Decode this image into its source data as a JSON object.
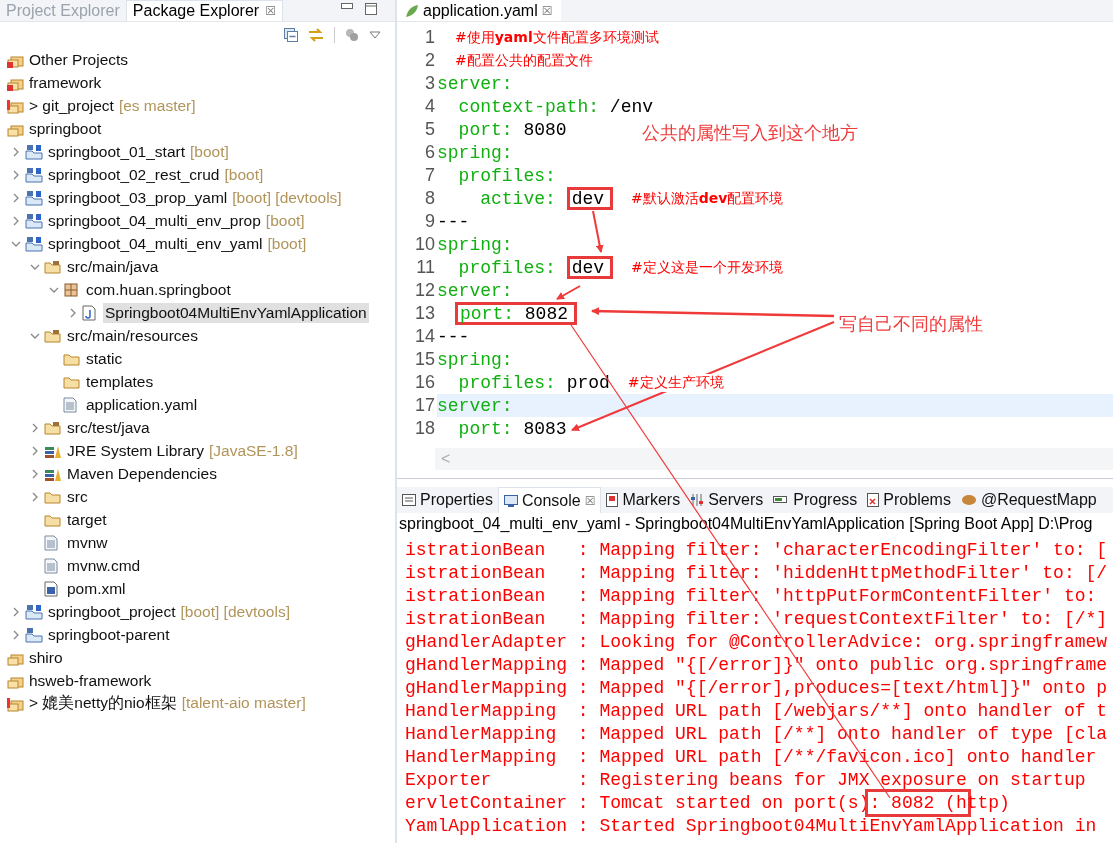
{
  "explorer": {
    "tabs": [
      {
        "label": "Project Explorer",
        "selected": false
      },
      {
        "label": "Package Explorer",
        "selected": true
      }
    ],
    "close_glyph": "☒",
    "tree": [
      {
        "label": "Other Projects",
        "kind": "closed-set",
        "selected": false
      },
      {
        "label": "framework",
        "kind": "closed-set",
        "selected": false
      },
      {
        "label": "> git_project",
        "decoration": "[es master]",
        "kind": "warn-set",
        "selected": false
      },
      {
        "label": "springboot",
        "kind": "set",
        "selected": false,
        "children": [
          {
            "label": "springboot_01_start",
            "decoration": "[boot]",
            "kind": "boot",
            "expanded": false,
            "selected": false
          },
          {
            "label": "springboot_02_rest_crud",
            "decoration": "[boot]",
            "kind": "boot",
            "expanded": false,
            "selected": false
          },
          {
            "label": "springboot_03_prop_yaml",
            "decoration": "[boot] [devtools]",
            "kind": "boot",
            "expanded": false,
            "selected": false
          },
          {
            "label": "springboot_04_multi_env_prop",
            "decoration": "[boot]",
            "kind": "boot",
            "expanded": false,
            "selected": false
          },
          {
            "label": "springboot_04_multi_env_yaml",
            "decoration": "[boot]",
            "kind": "boot",
            "expanded": true,
            "selected": false,
            "children": [
              {
                "label": "src/main/java",
                "kind": "src",
                "expanded": true,
                "selected": false,
                "children": [
                  {
                    "label": "com.huan.springboot",
                    "kind": "package",
                    "expanded": true,
                    "selected": false,
                    "children": [
                      {
                        "label": "Springboot04MultiEnvYamlApplication",
                        "kind": "java",
                        "expanded": false,
                        "selected": true
                      }
                    ]
                  }
                ]
              },
              {
                "label": "src/main/resources",
                "kind": "src",
                "expanded": true,
                "selected": false,
                "children": [
                  {
                    "label": "static",
                    "kind": "folder",
                    "selected": false
                  },
                  {
                    "label": "templates",
                    "kind": "folder",
                    "selected": false
                  },
                  {
                    "label": "application.yaml",
                    "kind": "file",
                    "selected": false
                  }
                ]
              },
              {
                "label": "src/test/java",
                "kind": "src",
                "expanded": false,
                "selected": false
              },
              {
                "label": "JRE System Library",
                "decoration": "[JavaSE-1.8]",
                "kind": "library",
                "expanded": false,
                "selected": false
              },
              {
                "label": "Maven Dependencies",
                "kind": "library",
                "expanded": false,
                "selected": false
              },
              {
                "label": "src",
                "kind": "folder",
                "expanded": false,
                "selected": false
              },
              {
                "label": "target",
                "kind": "folder",
                "selected": false
              },
              {
                "label": "mvnw",
                "kind": "file",
                "selected": false
              },
              {
                "label": "mvnw.cmd",
                "kind": "file",
                "selected": false
              },
              {
                "label": "pom.xml",
                "kind": "maven",
                "selected": false
              }
            ]
          },
          {
            "label": "springboot_project",
            "decoration": "[boot] [devtools]",
            "kind": "boot",
            "expanded": false,
            "selected": false
          },
          {
            "label": "springboot-parent",
            "kind": "maven-project",
            "expanded": false,
            "selected": false
          }
        ]
      },
      {
        "label": "shiro",
        "kind": "set",
        "selected": false
      },
      {
        "label": "hsweb-framework",
        "kind": "set",
        "selected": false
      },
      {
        "label": "> 媲美netty的nio框架",
        "decoration": "[talent-aio master]",
        "kind": "warn-set",
        "selected": false
      }
    ]
  },
  "editor": {
    "tab": {
      "label": "application.yaml",
      "selected": true
    },
    "close_glyph": "☒",
    "scroll_glyph": "<",
    "lines": [
      {
        "number": "1",
        "current": false,
        "tokens": [
          {
            "kind": "comment",
            "text": "#使用**yaml**文件配置多环境测试",
            "boxed": false
          }
        ]
      },
      {
        "number": "2",
        "current": false,
        "tokens": [
          {
            "kind": "comment",
            "text": "#配置公共的配置文件",
            "boxed": false
          }
        ]
      },
      {
        "number": "3",
        "current": false,
        "tokens": [
          {
            "kind": "key",
            "text": "server:",
            "boxed": false
          }
        ]
      },
      {
        "number": "4",
        "current": false,
        "tokens": [
          {
            "kind": "key",
            "text": "  context-path:",
            "boxed": false
          },
          {
            "kind": "value",
            "text": " /env",
            "boxed": false
          }
        ]
      },
      {
        "number": "5",
        "current": false,
        "tokens": [
          {
            "kind": "key",
            "text": "  port:",
            "boxed": false
          },
          {
            "kind": "value",
            "text": " 8080",
            "boxed": false
          }
        ]
      },
      {
        "number": "6",
        "current": false,
        "tokens": [
          {
            "kind": "key",
            "text": "spring:",
            "boxed": false
          }
        ]
      },
      {
        "number": "7",
        "current": false,
        "tokens": [
          {
            "kind": "key",
            "text": "  profiles:",
            "boxed": false
          }
        ]
      },
      {
        "number": "8",
        "current": false,
        "tokens": [
          {
            "kind": "key",
            "text": "    active: ",
            "boxed": false
          },
          {
            "kind": "value",
            "text": "dev",
            "boxed": true
          },
          {
            "kind": "comment",
            "text": "#默认激活**dev**配置环境",
            "boxed": false
          }
        ]
      },
      {
        "number": "9",
        "current": false,
        "tokens": [
          {
            "kind": "value",
            "text": "---",
            "boxed": false
          }
        ]
      },
      {
        "number": "10",
        "current": false,
        "tokens": [
          {
            "kind": "key",
            "text": "spring:",
            "boxed": false
          }
        ]
      },
      {
        "number": "11",
        "current": false,
        "tokens": [
          {
            "kind": "key",
            "text": "  profiles: ",
            "boxed": false
          },
          {
            "kind": "value",
            "text": "dev",
            "boxed": true
          },
          {
            "kind": "comment",
            "text": "#定义这是一个开发环境",
            "boxed": false
          }
        ]
      },
      {
        "number": "12",
        "current": false,
        "tokens": [
          {
            "kind": "key",
            "text": "server:",
            "boxed": false
          }
        ]
      },
      {
        "number": "13",
        "current": false,
        "tokens": [
          {
            "kind": "key",
            "text": "port:",
            "boxed": true
          },
          {
            "kind": "value",
            "text": " 8082",
            "boxed": true
          }
        ]
      },
      {
        "number": "14",
        "current": false,
        "tokens": [
          {
            "kind": "value",
            "text": "---",
            "boxed": false
          }
        ]
      },
      {
        "number": "15",
        "current": false,
        "tokens": [
          {
            "kind": "key",
            "text": "spring:",
            "boxed": false
          }
        ]
      },
      {
        "number": "16",
        "current": false,
        "tokens": [
          {
            "kind": "key",
            "text": "  profiles:",
            "boxed": false
          },
          {
            "kind": "value",
            "text": " prod",
            "boxed": false
          },
          {
            "kind": "comment",
            "text": "#定义生产环境",
            "boxed": false
          }
        ]
      },
      {
        "number": "17",
        "current": true,
        "tokens": [
          {
            "kind": "key",
            "text": "server:",
            "boxed": false
          }
        ]
      },
      {
        "number": "18",
        "current": false,
        "tokens": [
          {
            "kind": "key",
            "text": "  port:",
            "boxed": false
          },
          {
            "kind": "value",
            "text": " 8083",
            "boxed": false
          }
        ]
      }
    ],
    "annotations": [
      {
        "text": "公共的属性写入到这个地方"
      },
      {
        "text": "写自己不同的属性"
      }
    ]
  },
  "console": {
    "tabs": [
      {
        "label": "Properties",
        "kind": "properties",
        "selected": false
      },
      {
        "label": "Console",
        "kind": "console",
        "selected": true
      },
      {
        "label": "Markers",
        "kind": "markers",
        "selected": false
      },
      {
        "label": "Servers",
        "kind": "servers",
        "selected": false
      },
      {
        "label": "Progress",
        "kind": "progress",
        "selected": false
      },
      {
        "label": "Problems",
        "kind": "problems",
        "selected": false
      },
      {
        "label": "@RequestMapp",
        "kind": "mapping",
        "selected": false
      }
    ],
    "close_glyph": "☒",
    "header": "springboot_04_multi_env_yaml - Springboot04MultiEnvYamlApplication [Spring Boot App] D:\\Prog",
    "lines": [
      [
        {
          "text": "istrationBean   : Mapping filter: 'characterEncodingFilter' to: [",
          "boxed": false
        }
      ],
      [
        {
          "text": "istrationBean   : Mapping filter: 'hiddenHttpMethodFilter' to: [/",
          "boxed": false
        }
      ],
      [
        {
          "text": "istrationBean   : Mapping filter: 'httpPutFormContentFilter' to:",
          "boxed": false
        }
      ],
      [
        {
          "text": "istrationBean   : Mapping filter: 'requestContextFilter' to: [/*]",
          "boxed": false
        }
      ],
      [
        {
          "text": "gHandlerAdapter : Looking for @ControllerAdvice: org.springframew",
          "boxed": false
        }
      ],
      [
        {
          "text": "gHandlerMapping : Mapped \"{[/error]}\" onto public org.springframe",
          "boxed": false
        }
      ],
      [
        {
          "text": "gHandlerMapping : Mapped \"{[/error],produces=[text/html]}\" onto p",
          "boxed": false
        }
      ],
      [
        {
          "text": "HandlerMapping  : Mapped URL path [/webjars/**] onto handler of t",
          "boxed": false
        }
      ],
      [
        {
          "text": "HandlerMapping  : Mapped URL path [/**] onto handler of type [cla",
          "boxed": false
        }
      ],
      [
        {
          "text": "HandlerMapping  : Mapped URL path [/**/favicon.ico] onto handler",
          "boxed": false
        }
      ],
      [
        {
          "text": "Exporter        : Registering beans for JMX exposure on startup",
          "boxed": false
        }
      ],
      [
        {
          "text": "ervletContainer : Tomcat started on port(s)",
          "boxed": false
        },
        {
          "text": ": 8082 (h",
          "boxed": true
        },
        {
          "text": "ttp)",
          "boxed": false
        }
      ],
      [
        {
          "text": "YamlApplication : Started Springboot04MultiEnvYamlApplication in",
          "boxed": false
        }
      ]
    ]
  }
}
